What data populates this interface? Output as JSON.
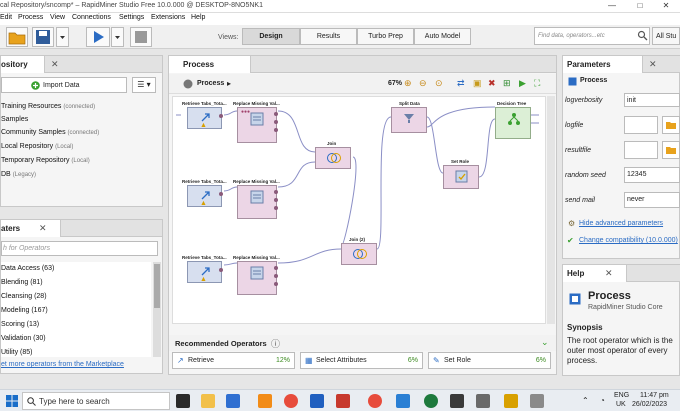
{
  "window": {
    "title": "cal Repository/sncomp* – RapidMiner Studio Free 10.0.000 @ DESKTOP-8NO5NK1",
    "controls": [
      "—",
      "□",
      "✕"
    ]
  },
  "menu": [
    "Edit",
    "Process",
    "View",
    "Connections",
    "Settings",
    "Extensions",
    "Help"
  ],
  "toolbar": {
    "views_label": "Views:",
    "views": [
      "Design",
      "Results",
      "Turbo Prep",
      "Auto Model"
    ],
    "active_view": "Design",
    "search_placeholder": "Find data, operators...etc",
    "search_scope": "All Stu"
  },
  "repository": {
    "tab": "ository",
    "import_label": "Import Data",
    "items": [
      {
        "label": "Training Resources",
        "note": "(connected)"
      },
      {
        "label": "Samples",
        "note": ""
      },
      {
        "label": "Community Samples",
        "note": "(connected)"
      },
      {
        "label": "Local Repository",
        "note": "(Local)"
      },
      {
        "label": "Temporary Repository",
        "note": "(Local)"
      },
      {
        "label": "DB",
        "note": "(Legacy)"
      }
    ]
  },
  "operators": {
    "tab": "aters",
    "search_placeholder": "h for Operators",
    "items": [
      "Data Access (63)",
      "Blending (81)",
      "Cleansing (28)",
      "Modeling (167)",
      "Scoring (13)",
      "Validation (30)",
      "Utility (85)"
    ],
    "marketplace_link": "et more operators from the Marketplace"
  },
  "process": {
    "tab": "Process",
    "breadcrumb": "Process",
    "zoom": "67%",
    "nodes": [
      {
        "id": "r1",
        "label": "Retrieve Tabs_Tota..."
      },
      {
        "id": "m1",
        "label": "Replace Missing Val..."
      },
      {
        "id": "r2",
        "label": "Retrieve Tabs_Tota..."
      },
      {
        "id": "m2",
        "label": "Replace Missing Val..."
      },
      {
        "id": "r3",
        "label": "Retrieve Tabs_Tota..."
      },
      {
        "id": "m3",
        "label": "Replace Missing Val..."
      },
      {
        "id": "j1",
        "label": "Join"
      },
      {
        "id": "j2",
        "label": "Join (2)"
      },
      {
        "id": "split",
        "label": "Split Data"
      },
      {
        "id": "setrole",
        "label": "Set Role"
      },
      {
        "id": "tree",
        "label": "Decision Tree"
      }
    ]
  },
  "recommended": {
    "title": "Recommended Operators",
    "items": [
      {
        "label": "Retrieve",
        "pct": "12%"
      },
      {
        "label": "Select Attributes",
        "pct": "6%"
      },
      {
        "label": "Set Role",
        "pct": "6%"
      }
    ]
  },
  "parameters": {
    "tab": "Parameters",
    "title": "Process",
    "rows": [
      {
        "label": "logverbosity",
        "value": "init"
      },
      {
        "label": "logfile",
        "value": ""
      },
      {
        "label": "resultfile",
        "value": ""
      },
      {
        "label": "random seed",
        "value": "12345"
      },
      {
        "label": "send mail",
        "value": "never"
      }
    ],
    "hide_advanced": "Hide advanced parameters",
    "compat": "Change compatibility (10.0.000)"
  },
  "help": {
    "tab": "Help",
    "title": "Process",
    "subtitle": "RapidMiner Studio Core",
    "synopsis_head": "Synopsis",
    "synopsis": "The root operator which is the outer most operator of every process."
  },
  "taskbar": {
    "search": "Type here to search",
    "lang": "ENG",
    "region": "UK",
    "time": "11:47 pm",
    "date": "26/02/2023"
  },
  "colors": {
    "accent": "#2b6cc4",
    "green": "#3b8a1f"
  }
}
